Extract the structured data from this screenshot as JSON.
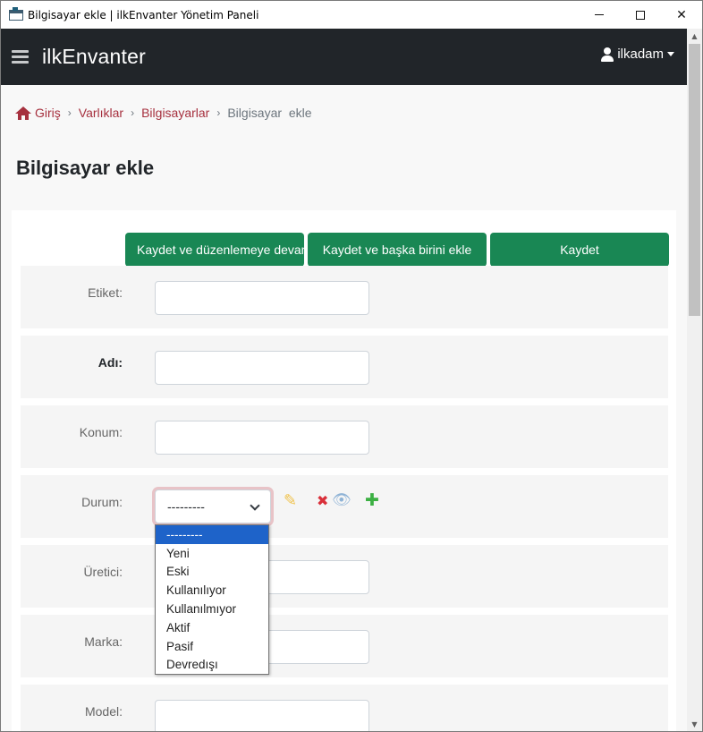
{
  "window": {
    "title": "Bilgisayar ekle | ilkEnvanter Yönetim Paneli",
    "minimize": "—",
    "maximize": "☐",
    "close": "✕"
  },
  "navbar": {
    "brand": "ilkEnvanter",
    "user": "ilkadam"
  },
  "breadcrumb": {
    "home": "Giriş",
    "items": [
      "Varlıklar",
      "Bilgisayarlar"
    ],
    "current": "Bilgisayar  ekle",
    "separator": "›"
  },
  "page": {
    "title": "Bilgisayar ekle"
  },
  "buttons": {
    "save_continue": "Kaydet ve düzenlemeye devam et",
    "save_add_another": "Kaydet ve başka birini ekle",
    "save": "Kaydet"
  },
  "fields": {
    "etiket": {
      "label": "Etiket:",
      "value": ""
    },
    "adi": {
      "label": "Adı:",
      "value": ""
    },
    "konum": {
      "label": "Konum:",
      "value": ""
    },
    "durum": {
      "label": "Durum:",
      "value": "---------"
    },
    "uretici": {
      "label": "Üretici:",
      "value": ""
    },
    "marka": {
      "label": "Marka:",
      "value": ""
    },
    "model": {
      "label": "Model:",
      "value": ""
    }
  },
  "related_icons": {
    "edit": "✎",
    "delete": "✖",
    "view": "👁",
    "add": "✚"
  },
  "durum_options": [
    "---------",
    "Yeni",
    "Eski",
    "Kullanılıyor",
    "Kullanılmıyor",
    "Aktif",
    "Pasif",
    "Devredışı"
  ],
  "colors": {
    "navbar": "#212529",
    "accent": "#a6303e",
    "primary_button": "#198754",
    "selected_option": "#1e63c9"
  }
}
